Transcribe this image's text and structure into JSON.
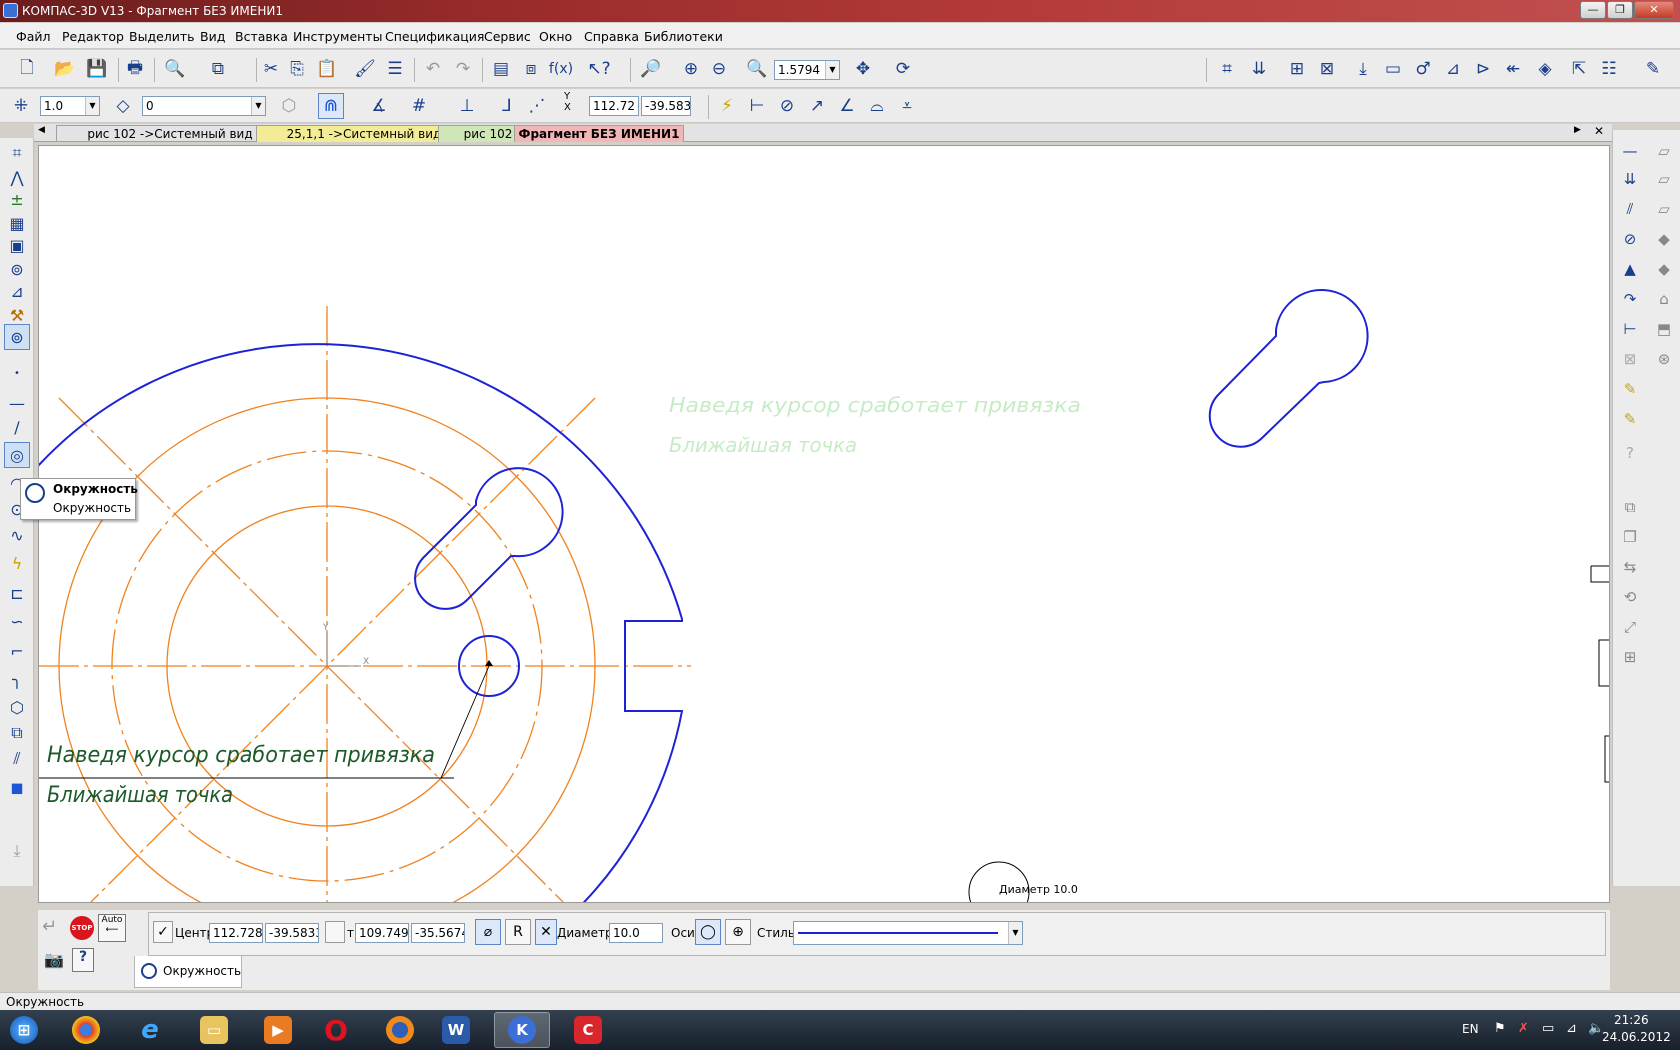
{
  "window": {
    "title": "КОМПАС-3D V13 - Фрагмент БЕЗ ИМЕНИ1",
    "minimize": "—",
    "restore": "❐",
    "close": "✕"
  },
  "menu": [
    "Файл",
    "Редактор",
    "Выделить",
    "Вид",
    "Вставка",
    "Инструменты",
    "Спецификация",
    "Сервис",
    "Окно",
    "Справка",
    "Библиотеки"
  ],
  "toolbar": {
    "zoom_value": "1.5794",
    "step_value": "1.0",
    "layer_value": "0",
    "coord_x": "112.72",
    "coord_y": "-39.583"
  },
  "doc_tabs": [
    {
      "label": "рис 102 ->Системный вид",
      "color": "#c9daf5"
    },
    {
      "label": "25,1,1 ->Системный вид",
      "color": "#f3ec96"
    },
    {
      "label": "рис 102",
      "color": "#cfe6b6"
    },
    {
      "label": "Фрагмент БЕЗ ИМЕНИ1",
      "color": "#f2b6b6"
    }
  ],
  "tooltip": {
    "title": "Окружность",
    "subtitle": "Окружность"
  },
  "canvas": {
    "hint_line1": "Наведя курсор сработает привязка",
    "hint_line2": "Ближайшая точка",
    "ghost_line1": "Наведя курсор сработает привязка",
    "ghost_line2": "Ближайшая точка",
    "diameter_label": "Диаметр 10.0",
    "axis_x": "X",
    "axis_y": "Y",
    "colors": {
      "contour": "#1e22d6",
      "axis": "#f0821e",
      "hint": "#1c5a2a"
    }
  },
  "props": {
    "auto_label": "Auto",
    "center_label": "Центр",
    "center_x": "112.7282",
    "center_y": "-39.5833",
    "point_label": "т",
    "point_x": "109.7496",
    "point_y": "-35.5674",
    "r_label": "R",
    "diameter_label": "Диаметр",
    "diameter_value": "10.0",
    "axes_label": "Оси",
    "style_label": "Стиль",
    "tab_label": "Окружность"
  },
  "status": "Окружность",
  "taskbar": {
    "lang": "EN",
    "time": "21:26",
    "date": "24.06.2012",
    "apps": [
      "windows-start",
      "chrome",
      "internet-explorer",
      "file-explorer",
      "media-player",
      "opera",
      "firefox",
      "word",
      "kompas",
      "ascon"
    ]
  }
}
